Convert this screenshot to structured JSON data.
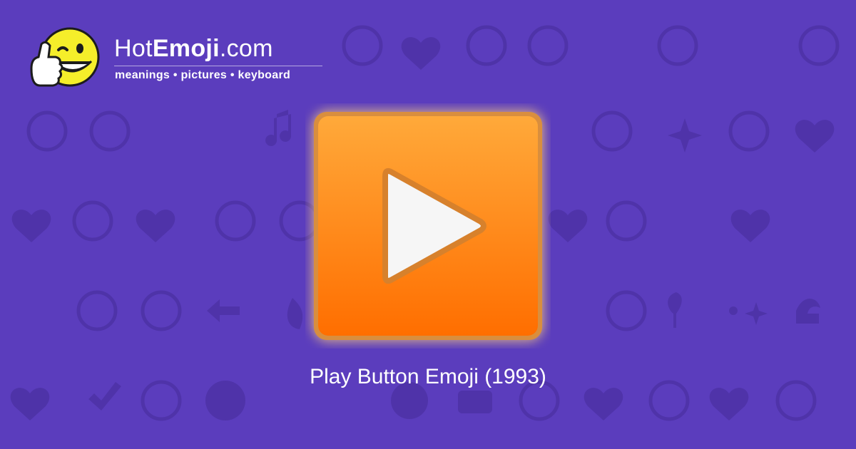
{
  "brand": {
    "name_prefix": "Hot",
    "name_bold": "Emoji",
    "name_suffix": ".com",
    "tagline": "meanings • pictures • keyboard"
  },
  "caption": "Play Button Emoji (1993)",
  "emoji": {
    "name": "play-button",
    "icon": "play-icon"
  },
  "colors": {
    "background": "#5b3dbd",
    "pattern": "#2a1a70",
    "button_top": "#ffa93a",
    "button_bottom": "#ff6e00",
    "glow": "#ffd27a",
    "logo_face": "#f5ee2a"
  }
}
